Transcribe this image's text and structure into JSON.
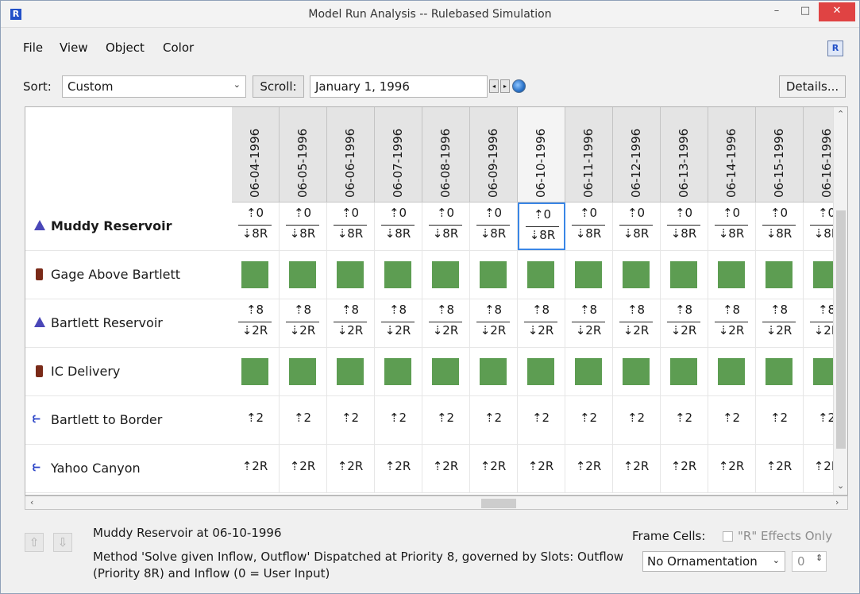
{
  "window": {
    "title": "Model Run Analysis -- Rulebased Simulation",
    "app_icon": "R",
    "minimize": "–",
    "maximize": "□",
    "close": "✕"
  },
  "menu": {
    "file": "File",
    "view": "View",
    "object": "Object",
    "color": "Color"
  },
  "toolbar": {
    "sort_label": "Sort:",
    "sort_value": "Custom",
    "scroll_label": "Scroll:",
    "date_value": "January 1, 1996",
    "details_label": "Details...",
    "prev": "◂",
    "next": "▸"
  },
  "dates": [
    "06-04-1996",
    "06-05-1996",
    "06-06-1996",
    "06-07-1996",
    "06-08-1996",
    "06-09-1996",
    "06-10-1996",
    "06-11-1996",
    "06-12-1996",
    "06-13-1996",
    "06-14-1996",
    "06-15-1996",
    "06-16-1996"
  ],
  "selected_date_index": 6,
  "rows": [
    {
      "name": "Muddy Reservoir",
      "icon": "reservoir-icon",
      "bold": true,
      "kind": "fraction",
      "top": "⇡0",
      "bottom": "⇣8R"
    },
    {
      "name": "Gage Above Bartlett",
      "icon": "gage-icon",
      "bold": false,
      "kind": "green"
    },
    {
      "name": "Bartlett Reservoir",
      "icon": "reservoir-icon",
      "bold": false,
      "kind": "fraction",
      "top": "⇡8",
      "bottom": "⇣2R"
    },
    {
      "name": "IC Delivery",
      "icon": "gage-icon",
      "bold": false,
      "kind": "green"
    },
    {
      "name": "Bartlett to Border",
      "icon": "reach-icon",
      "bold": false,
      "kind": "single",
      "value": "⇡2"
    },
    {
      "name": "Yahoo Canyon",
      "icon": "reach-icon",
      "bold": false,
      "kind": "single",
      "value": "⇡2R"
    }
  ],
  "colors": {
    "cell_fill": "#5d9d52",
    "selection": "#3a86e6",
    "reservoir": "#4a47b8",
    "gage": "#7a2a18",
    "reach": "#2e47c8"
  },
  "status": {
    "title": "Muddy Reservoir at 06-10-1996",
    "description": "Method 'Solve given Inflow, Outflow' Dispatched at Priority 8, governed by Slots: Outflow (Priority 8R) and Inflow (0 = User Input)",
    "up": "⇧",
    "down": "⇩",
    "frame_cells_label": "Frame Cells:",
    "effects_label": "\"R\" Effects Only",
    "ornamentation_value": "No Ornamentation",
    "number_value": "0"
  }
}
